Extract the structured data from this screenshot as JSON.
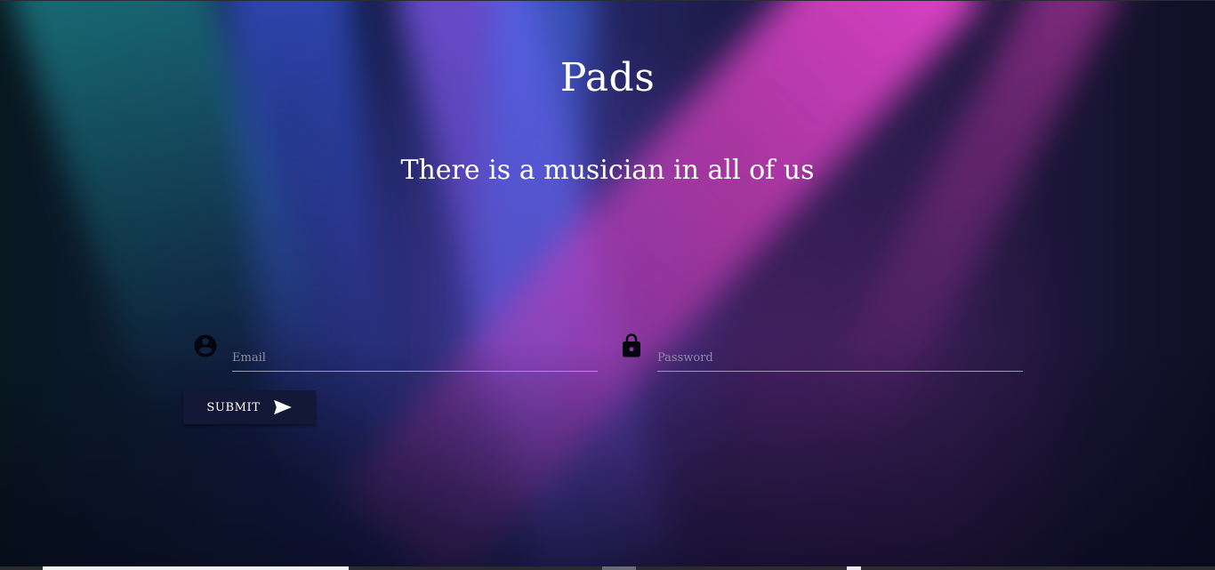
{
  "header": {
    "title": "Pads",
    "subtitle": "There is a musician in all of us"
  },
  "form": {
    "email": {
      "placeholder": "Email",
      "value": "",
      "icon": "account-circle-icon"
    },
    "password": {
      "placeholder": "Password",
      "value": "",
      "icon": "lock-icon"
    },
    "submit": {
      "label": "Submit",
      "icon": "send-icon"
    }
  },
  "colors": {
    "text": "#ffffff",
    "icon": "#05050f",
    "button_bg": "#121836",
    "underline": "#9a9ab0",
    "beam_pink": "#f046d2",
    "beam_teal": "#1e8c96",
    "beam_violet": "#825af0"
  }
}
